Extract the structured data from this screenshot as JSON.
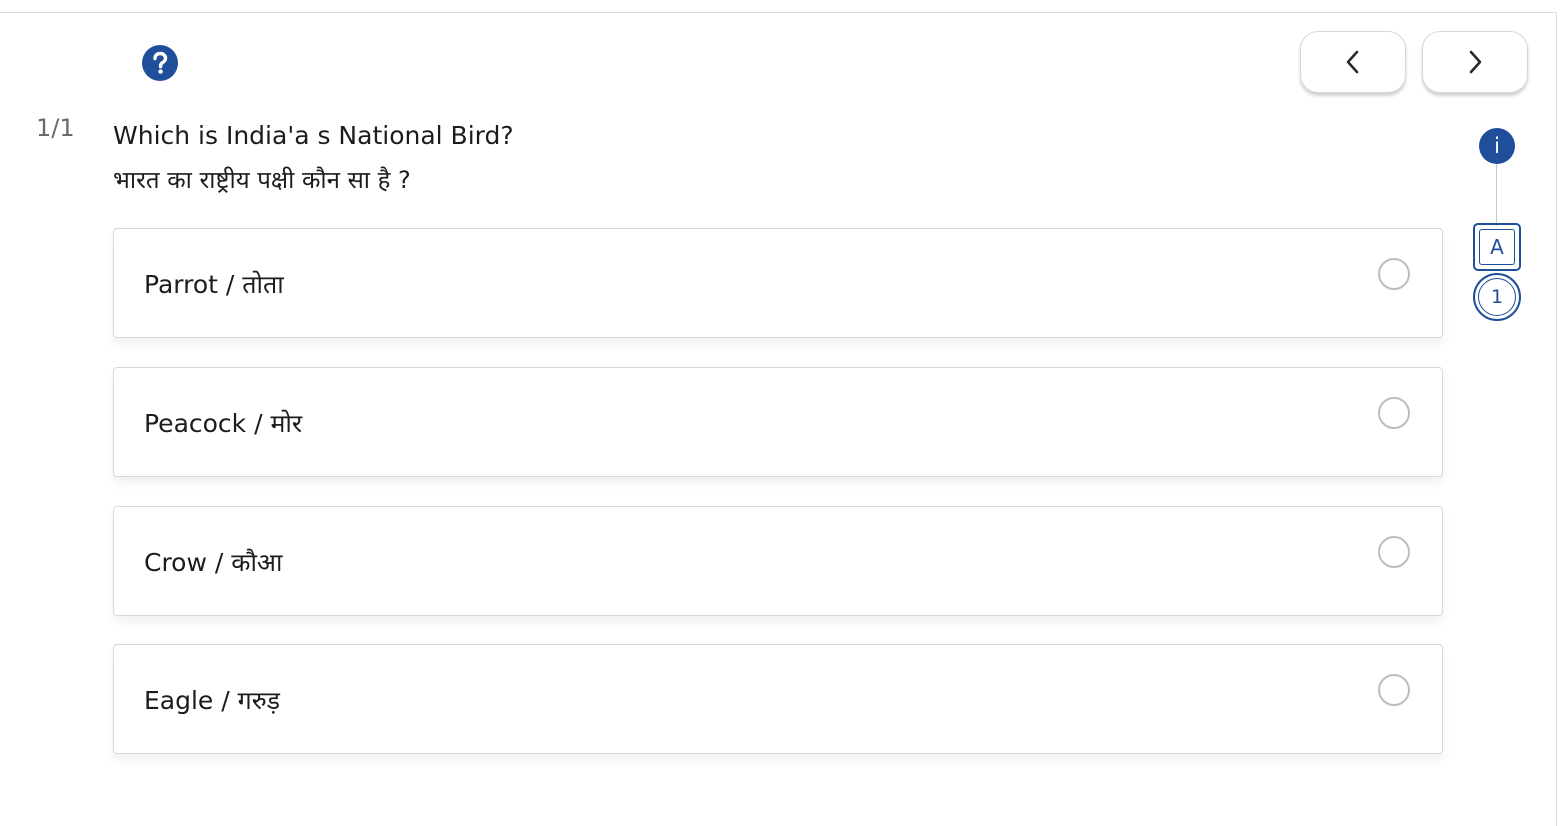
{
  "question": {
    "counter": "1/1",
    "text_en": "Which is India'a s National Bird?",
    "text_hi": "भारत का राष्ट्रीय पक्षी कौन सा है ?"
  },
  "options": [
    {
      "label": "Parrot / तोता"
    },
    {
      "label": "Peacock / मोर"
    },
    {
      "label": "Crow / कौआ"
    },
    {
      "label": "Eagle / गरुड़"
    }
  ],
  "sidebar": {
    "info_label": "i",
    "answer_label": "A",
    "question_number": "1"
  },
  "icons": {
    "help": "question-circle-icon",
    "prev": "chevron-left-icon",
    "next": "chevron-right-icon",
    "info": "info-icon"
  },
  "colors": {
    "accent": "#1f4e9a",
    "radio_border": "#bdbdbd",
    "option_border": "#d9d9d9"
  }
}
